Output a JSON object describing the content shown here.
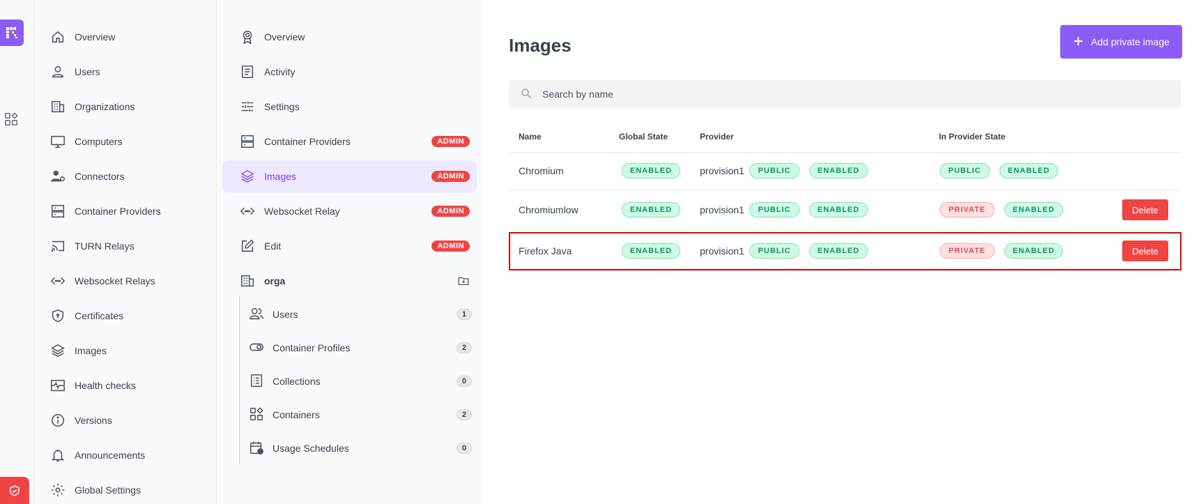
{
  "colors": {
    "accent": "#8b5cf6",
    "danger": "#ef4444",
    "success": "#059669",
    "highlight": "#e00000"
  },
  "sidebar": {
    "items": [
      {
        "label": "Overview",
        "icon": "home-icon"
      },
      {
        "label": "Users",
        "icon": "user-icon"
      },
      {
        "label": "Organizations",
        "icon": "building-icon"
      },
      {
        "label": "Computers",
        "icon": "monitor-icon"
      },
      {
        "label": "Connectors",
        "icon": "user-gear-icon"
      },
      {
        "label": "Container Providers",
        "icon": "server-icon"
      },
      {
        "label": "TURN Relays",
        "icon": "cast-icon"
      },
      {
        "label": "Websocket Relays",
        "icon": "code-arrows-icon"
      },
      {
        "label": "Certificates",
        "icon": "shield-icon"
      },
      {
        "label": "Images",
        "icon": "layers-icon"
      },
      {
        "label": "Health checks",
        "icon": "pulse-icon"
      },
      {
        "label": "Versions",
        "icon": "info-icon"
      },
      {
        "label": "Announcements",
        "icon": "bell-icon"
      },
      {
        "label": "Global Settings",
        "icon": "gear-icon"
      }
    ]
  },
  "sidebar2": {
    "items": [
      {
        "label": "Overview",
        "icon": "badge-icon",
        "badge": ""
      },
      {
        "label": "Activity",
        "icon": "document-icon",
        "badge": ""
      },
      {
        "label": "Settings",
        "icon": "sliders-icon",
        "badge": ""
      },
      {
        "label": "Container Providers",
        "icon": "server-icon",
        "badge": "ADMIN"
      },
      {
        "label": "Images",
        "icon": "layers-icon",
        "badge": "ADMIN"
      },
      {
        "label": "Websocket Relay",
        "icon": "code-arrows-icon",
        "badge": "ADMIN"
      },
      {
        "label": "Edit",
        "icon": "edit-icon",
        "badge": "ADMIN"
      }
    ],
    "org": {
      "label": "orga",
      "icon": "building-icon",
      "action_icon": "folder-add-icon"
    },
    "sub_items": [
      {
        "label": "Users",
        "count": "1",
        "icon": "users-icon"
      },
      {
        "label": "Container Profiles",
        "count": "2",
        "icon": "toggle-icon"
      },
      {
        "label": "Collections",
        "count": "0",
        "icon": "list-icon"
      },
      {
        "label": "Containers",
        "count": "2",
        "icon": "apps-icon"
      },
      {
        "label": "Usage Schedules",
        "count": "0",
        "icon": "calendar-clock-icon"
      }
    ]
  },
  "main": {
    "title": "Images",
    "add_button": "Add private image",
    "search_placeholder": "Search by name",
    "columns": {
      "name": "Name",
      "global_state": "Global State",
      "provider": "Provider",
      "in_provider_state": "In Provider State"
    },
    "rows": [
      {
        "name": "Chromium",
        "global_state": "ENABLED",
        "provider": "provision1",
        "provider_visibility": "PUBLIC",
        "provider_state": "ENABLED",
        "in_visibility": "PUBLIC",
        "in_state": "ENABLED",
        "action": ""
      },
      {
        "name": "Chromiumlow",
        "global_state": "ENABLED",
        "provider": "provision1",
        "provider_visibility": "PUBLIC",
        "provider_state": "ENABLED",
        "in_visibility": "PRIVATE",
        "in_state": "ENABLED",
        "action": "Delete"
      },
      {
        "name": "Firefox Java",
        "global_state": "ENABLED",
        "provider": "provision1",
        "provider_visibility": "PUBLIC",
        "provider_state": "ENABLED",
        "in_visibility": "PRIVATE",
        "in_state": "ENABLED",
        "action": "Delete"
      }
    ]
  }
}
